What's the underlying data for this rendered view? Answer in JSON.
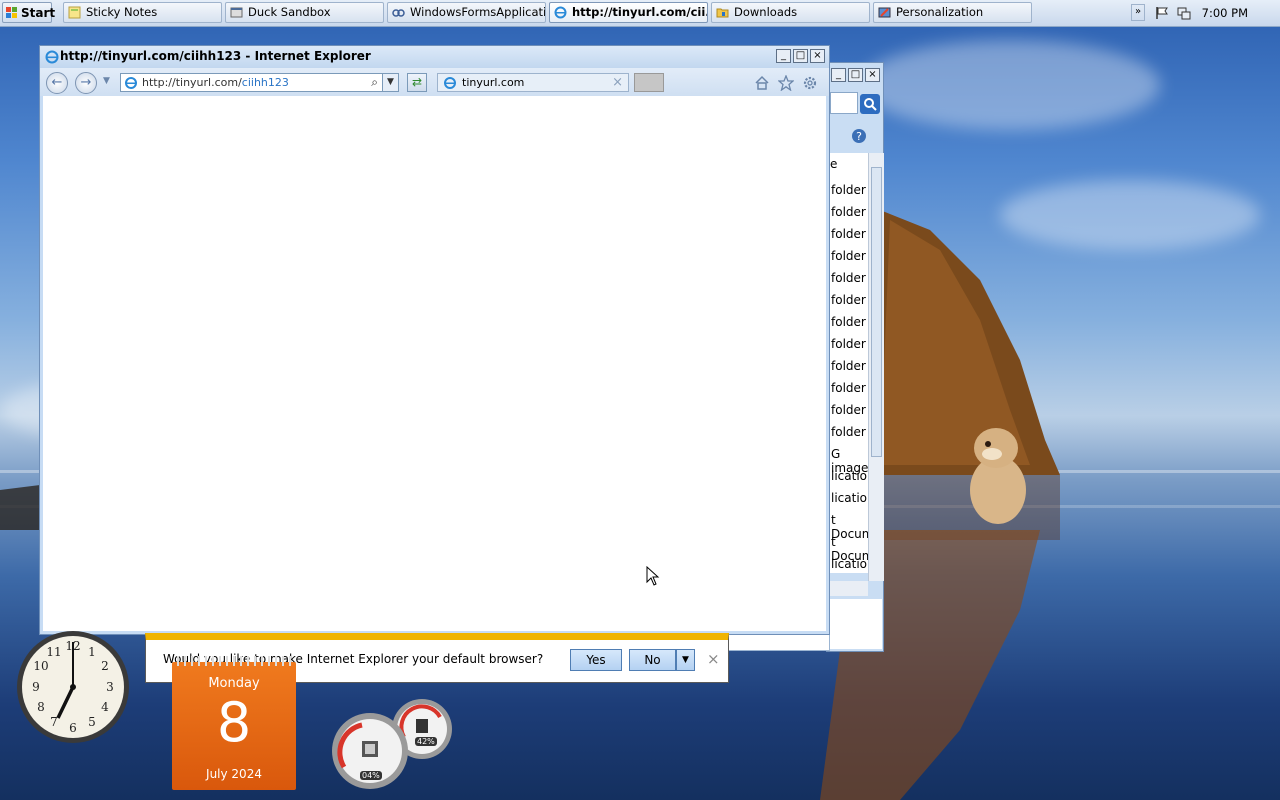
{
  "taskbar": {
    "start_label": "Start",
    "buttons": [
      {
        "label": "Sticky Notes",
        "icon": "sticky-notes-icon"
      },
      {
        "label": "Duck Sandbox",
        "icon": "app-window-icon"
      },
      {
        "label": "WindowsFormsApplicatio...",
        "icon": "link-icon"
      },
      {
        "label": "http://tinyurl.com/cii...",
        "icon": "ie-icon",
        "active": true
      },
      {
        "label": "Downloads",
        "icon": "folder-icon"
      },
      {
        "label": "Personalization",
        "icon": "personalization-icon"
      }
    ],
    "clock": "7:00 PM"
  },
  "ie_window": {
    "title": "http://tinyurl.com/ciihh123 - Internet Explorer",
    "address_host": "http://tinyurl.com/",
    "address_path": "ciihh123",
    "tab_label": "tinyurl.com",
    "tab_close": "×",
    "notification": {
      "message": "Would you like to make Internet Explorer your default browser?",
      "yes_label": "Yes",
      "no_label": "No",
      "close": "×"
    }
  },
  "background_window": {
    "rows": [
      "folder",
      "folder",
      "folder",
      "folder",
      "folder",
      "folder",
      "folder",
      "folder",
      "folder",
      "folder",
      "folder",
      "folder",
      "G image",
      "lication",
      "lication",
      "t Docum",
      "t Docum",
      "lication"
    ],
    "header_fragment": "e"
  },
  "gadgets": {
    "calendar": {
      "weekday": "Monday",
      "day": "8",
      "month_year": "July 2024"
    },
    "cpu_meter": {
      "cpu": "04%",
      "memory": "42%"
    }
  },
  "colors": {
    "accent": "#f0b400",
    "calendar": "#e8661a"
  }
}
